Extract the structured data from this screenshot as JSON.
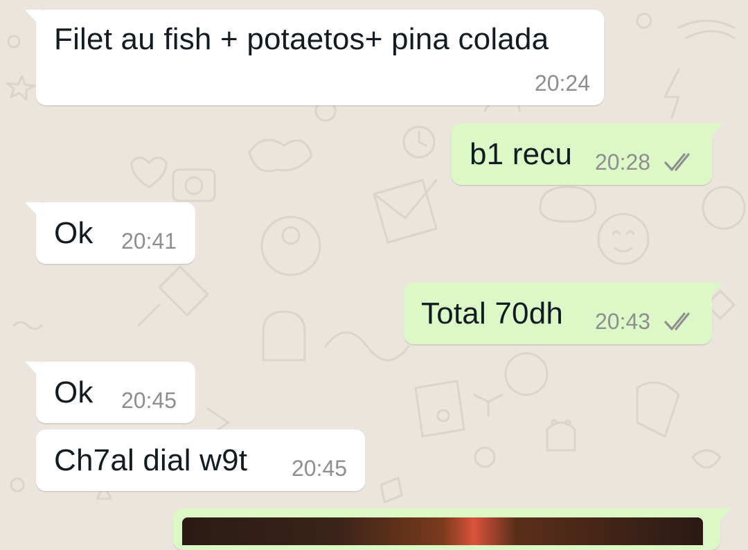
{
  "messages": [
    {
      "direction": "in",
      "text": "Filet au fish + potaetos+ pina colada",
      "time": "20:24"
    },
    {
      "direction": "out",
      "text": "b1 recu",
      "time": "20:28",
      "status_icon": "double-check-icon"
    },
    {
      "direction": "in",
      "text": "Ok",
      "time": "20:41"
    },
    {
      "direction": "out",
      "text": "Total 70dh",
      "time": "20:43",
      "status_icon": "double-check-icon"
    },
    {
      "direction": "in",
      "text": "Ok",
      "time": "20:45"
    },
    {
      "direction": "in",
      "text": "Ch7al dial w9t",
      "time": "20:45"
    },
    {
      "direction": "out",
      "type": "image",
      "text": "",
      "time": ""
    }
  ],
  "colors": {
    "background": "#ece5dd",
    "incoming_bubble": "#ffffff",
    "outgoing_bubble": "#dcf8c6",
    "timestamp": "#8e8e8e",
    "text": "#111b21",
    "ticks": "#8e8e8e"
  }
}
